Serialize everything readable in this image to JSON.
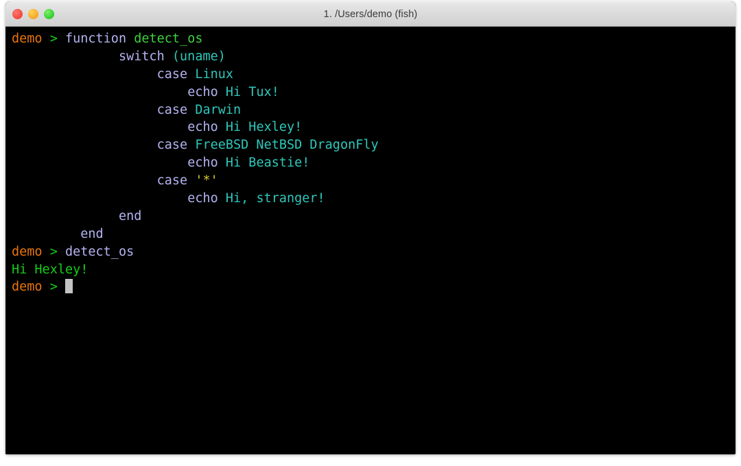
{
  "window": {
    "title": "1. /Users/demo (fish)",
    "traffic_lights": [
      {
        "name": "close",
        "color": "#f2453d"
      },
      {
        "name": "minimize",
        "color": "#f5a623"
      },
      {
        "name": "maximize",
        "color": "#2fcc2f"
      }
    ]
  },
  "theme": {
    "background": "#000000",
    "prompt_host": "#e8740c",
    "prompt_arrow": "#15cc15",
    "keyword": "#b4b4f2",
    "function_name": "#3fd13f",
    "argument": "#2fc8bb",
    "quoted_string": "#d8cc2e",
    "output": "#15cc15",
    "cursor": "#c3c3c3"
  },
  "terminal": {
    "shell": "fish",
    "prompt_host": "demo",
    "prompt_arrow": ">",
    "lines": [
      {
        "indent": 0,
        "prompt": true,
        "segments": [
          {
            "text": "function ",
            "kind": "keyword"
          },
          {
            "text": "detect_os",
            "kind": "funcname"
          }
        ]
      },
      {
        "indent": 14,
        "prompt": false,
        "segments": [
          {
            "text": "switch ",
            "kind": "keyword"
          },
          {
            "text": "(uname)",
            "kind": "arg"
          }
        ]
      },
      {
        "indent": 19,
        "prompt": false,
        "segments": [
          {
            "text": "case ",
            "kind": "keyword"
          },
          {
            "text": "Linux",
            "kind": "arg"
          }
        ]
      },
      {
        "indent": 23,
        "prompt": false,
        "segments": [
          {
            "text": "echo ",
            "kind": "command"
          },
          {
            "text": "Hi Tux!",
            "kind": "arg"
          }
        ]
      },
      {
        "indent": 19,
        "prompt": false,
        "segments": [
          {
            "text": "case ",
            "kind": "keyword"
          },
          {
            "text": "Darwin",
            "kind": "arg"
          }
        ]
      },
      {
        "indent": 23,
        "prompt": false,
        "segments": [
          {
            "text": "echo ",
            "kind": "command"
          },
          {
            "text": "Hi Hexley!",
            "kind": "arg"
          }
        ]
      },
      {
        "indent": 19,
        "prompt": false,
        "segments": [
          {
            "text": "case ",
            "kind": "keyword"
          },
          {
            "text": "FreeBSD NetBSD DragonFly",
            "kind": "arg"
          }
        ]
      },
      {
        "indent": 23,
        "prompt": false,
        "segments": [
          {
            "text": "echo ",
            "kind": "command"
          },
          {
            "text": "Hi Beastie!",
            "kind": "arg"
          }
        ]
      },
      {
        "indent": 19,
        "prompt": false,
        "segments": [
          {
            "text": "case ",
            "kind": "keyword"
          },
          {
            "text": "'*'",
            "kind": "quote"
          }
        ]
      },
      {
        "indent": 23,
        "prompt": false,
        "segments": [
          {
            "text": "echo ",
            "kind": "command"
          },
          {
            "text": "Hi, stranger!",
            "kind": "arg"
          }
        ]
      },
      {
        "indent": 14,
        "prompt": false,
        "segments": [
          {
            "text": "end",
            "kind": "keyword"
          }
        ]
      },
      {
        "indent": 9,
        "prompt": false,
        "segments": [
          {
            "text": "end",
            "kind": "keyword"
          }
        ]
      },
      {
        "indent": 0,
        "prompt": true,
        "segments": [
          {
            "text": "detect_os",
            "kind": "command"
          }
        ]
      },
      {
        "indent": 0,
        "prompt": false,
        "segments": [
          {
            "text": "Hi Hexley!",
            "kind": "output"
          }
        ]
      },
      {
        "indent": 0,
        "prompt": true,
        "cursor": true,
        "segments": []
      }
    ]
  }
}
